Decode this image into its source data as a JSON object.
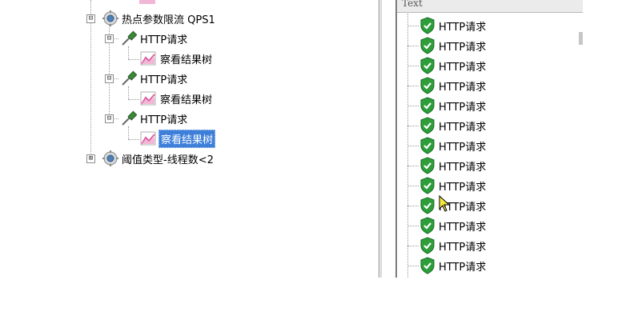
{
  "left_tree": {
    "nodes": [
      {
        "label": "热点参数限流 QPS1",
        "icon": "gear-icon",
        "toggle": "⊟"
      },
      {
        "label": "HTTP请求",
        "icon": "pipette-sampler-icon",
        "toggle": "⊟"
      },
      {
        "label": "察看结果树",
        "icon": "graph-listener-icon"
      },
      {
        "label": "HTTP请求",
        "icon": "pipette-sampler-icon",
        "toggle": "⊟"
      },
      {
        "label": "察看结果树",
        "icon": "graph-listener-icon"
      },
      {
        "label": "HTTP请求",
        "icon": "pipette-sampler-icon",
        "toggle": "⊟"
      },
      {
        "label": "察看结果树",
        "icon": "graph-listener-icon",
        "selected": true
      },
      {
        "label": "阈值类型-线程数<2",
        "icon": "gear-icon",
        "toggle": "⊞"
      }
    ]
  },
  "right_panel": {
    "header": "Text",
    "items": [
      "HTTP请求",
      "HTTP请求",
      "HTTP请求",
      "HTTP请求",
      "HTTP请求",
      "HTTP请求",
      "HTTP请求",
      "HTTP请求",
      "HTTP请求",
      "HTTP请求",
      "HTTP请求",
      "HTTP请求",
      "HTTP请求"
    ],
    "item_icon": "green-shield-check-icon"
  },
  "colors": {
    "selection": "#3d7fd9",
    "shield_green": "#2e9e3a"
  }
}
